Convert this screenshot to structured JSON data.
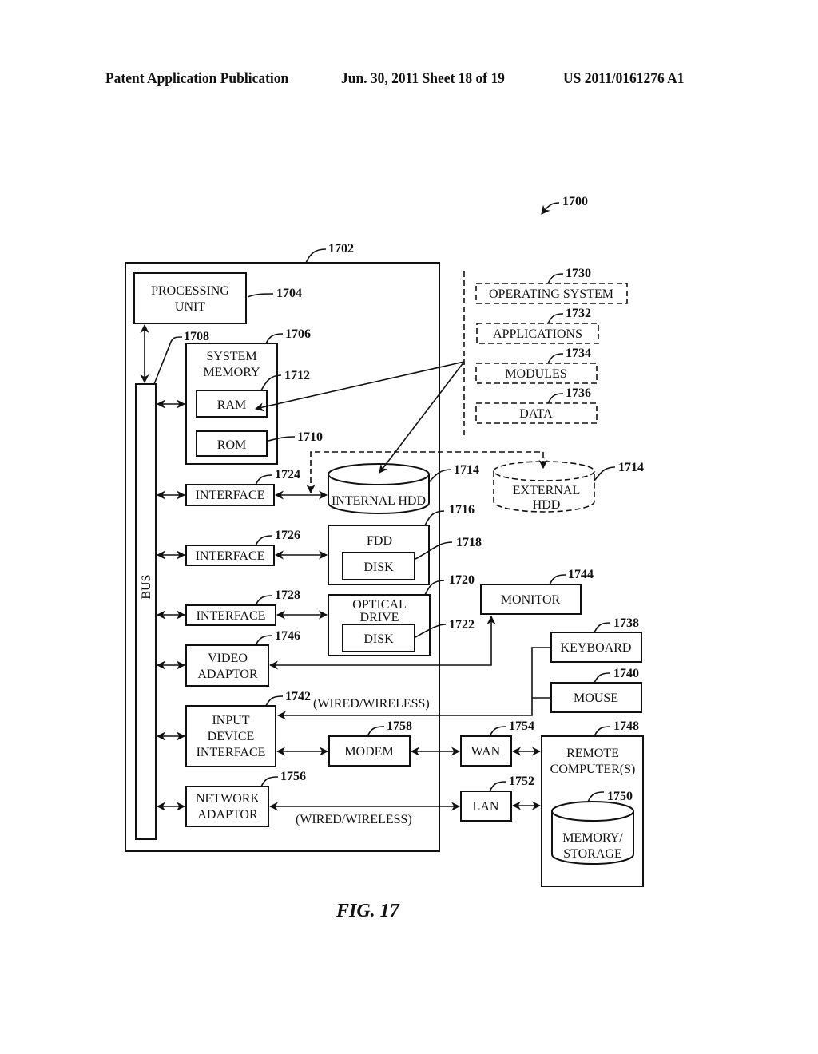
{
  "header": {
    "left": "Patent Application Publication",
    "center": "Jun. 30, 2011  Sheet 18 of 19",
    "right": "US 2011/0161276 A1"
  },
  "figure": {
    "caption": "FIG. 17",
    "system_ref": "1700",
    "computer_ref": "1702",
    "components": {
      "processing_unit": {
        "lines": [
          "PROCESSING",
          "UNIT"
        ],
        "ref": "1704"
      },
      "system_memory": {
        "lines": [
          "SYSTEM",
          "MEMORY"
        ],
        "ref": "1706"
      },
      "bus": {
        "label": "BUS",
        "ref": "1708"
      },
      "rom": {
        "label": "ROM",
        "ref": "1710"
      },
      "ram": {
        "label": "RAM",
        "ref": "1712"
      },
      "internal_hdd": {
        "label": "INTERNAL HDD",
        "ref": "1714"
      },
      "external_hdd": {
        "lines": [
          "EXTERNAL",
          "HDD"
        ],
        "ref": "1714"
      },
      "fdd": {
        "label": "FDD",
        "ref": "1716"
      },
      "fdd_disk": {
        "label": "DISK",
        "ref": "1718"
      },
      "optical_drive": {
        "lines": [
          "OPTICAL",
          "DRIVE"
        ],
        "ref": "1720"
      },
      "optical_disk": {
        "label": "DISK",
        "ref": "1722"
      },
      "interface_1": {
        "label": "INTERFACE",
        "ref": "1724"
      },
      "interface_2": {
        "label": "INTERFACE",
        "ref": "1726"
      },
      "interface_3": {
        "label": "INTERFACE",
        "ref": "1728"
      },
      "operating_system": {
        "label": "OPERATING SYSTEM",
        "ref": "1730"
      },
      "applications": {
        "label": "APPLICATIONS",
        "ref": "1732"
      },
      "modules": {
        "label": "MODULES",
        "ref": "1734"
      },
      "data": {
        "label": "DATA",
        "ref": "1736"
      },
      "keyboard": {
        "label": "KEYBOARD",
        "ref": "1738"
      },
      "mouse": {
        "label": "MOUSE",
        "ref": "1740"
      },
      "input_device_interface": {
        "lines": [
          "INPUT",
          "DEVICE",
          "INTERFACE"
        ],
        "ref": "1742"
      },
      "monitor": {
        "label": "MONITOR",
        "ref": "1744"
      },
      "video_adaptor": {
        "lines": [
          "VIDEO",
          "ADAPTOR"
        ],
        "ref": "1746"
      },
      "remote_computers": {
        "lines": [
          "REMOTE",
          "COMPUTER(S)"
        ],
        "ref": "1748"
      },
      "memory_storage": {
        "lines": [
          "MEMORY/",
          "STORAGE"
        ],
        "ref": "1750"
      },
      "lan": {
        "label": "LAN",
        "ref": "1752"
      },
      "wan": {
        "label": "WAN",
        "ref": "1754"
      },
      "network_adaptor": {
        "lines": [
          "NETWORK",
          "ADAPTOR"
        ],
        "ref": "1756"
      },
      "modem": {
        "label": "MODEM",
        "ref": "1758"
      }
    },
    "annotations": {
      "wired_wireless_input": "(WIRED/WIRELESS)",
      "wired_wireless_network": "(WIRED/WIRELESS)"
    }
  }
}
